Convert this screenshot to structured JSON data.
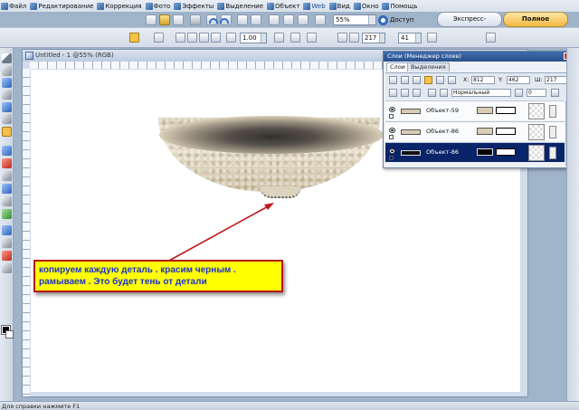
{
  "menu": {
    "items": [
      "Файл",
      "Редактирование",
      "Коррекция",
      "Фото",
      "Эффекты",
      "Выделение",
      "Объект",
      "Web",
      "Вид",
      "Окно",
      "Помощь"
    ]
  },
  "toolbar": {
    "zoom": "55%",
    "access_label": "Доступ",
    "express_mode": "Экспресс-коррекция",
    "full_mode": "Полное редактиров..."
  },
  "propbar": {
    "size": "1.00",
    "w": "217",
    "h": "41"
  },
  "document": {
    "title": "Untitled - 1 @55% (RGB)"
  },
  "callout": {
    "line1": "копируем каждую деталь . красим черным .",
    "line2": "рамываем . Это будет тень от детали"
  },
  "layers_panel": {
    "title": "Слои (Менеджер слоев)",
    "tabs": [
      "Слои",
      "Выделения"
    ],
    "x_label": "X:",
    "x_value": "812",
    "y_label": "Y:",
    "y_value": "462",
    "w_label": "Ш:",
    "w_value": "217",
    "blend_mode": "Нормальный",
    "opacity": "0",
    "layers": [
      {
        "name": "Объект-59",
        "selected": false
      },
      {
        "name": "Объект-86",
        "selected": false
      },
      {
        "name": "Объект-86",
        "selected": true
      }
    ]
  },
  "status": {
    "text": "Для справки нажмите F1"
  },
  "colors": {
    "callout_bg": "#ffff00",
    "callout_text": "#1a2fd0",
    "callout_border": "#b5141a",
    "arrow": "#c01818",
    "selected_layer": "#0a246a"
  }
}
